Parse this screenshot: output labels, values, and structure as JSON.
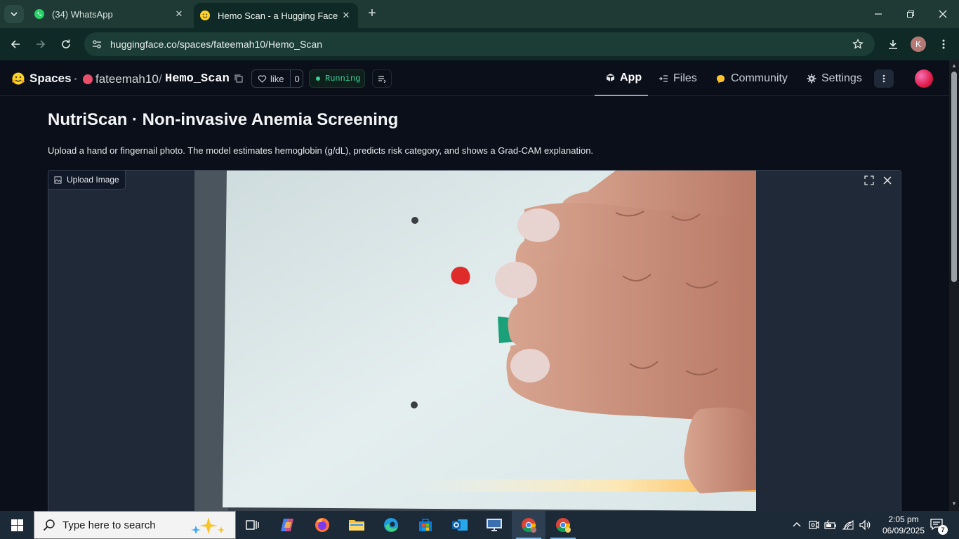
{
  "browser": {
    "tabs": [
      {
        "title": "(34) WhatsApp",
        "icon": "whatsapp-icon"
      },
      {
        "title": "Hemo Scan - a Hugging Face Space",
        "icon": "huggingface-icon"
      }
    ],
    "url": "huggingface.co/spaces/fateemah10/Hemo_Scan",
    "profile_initial": "K"
  },
  "hf_header": {
    "spaces_label": "Spaces",
    "owner": "fateemah10",
    "separator": "/",
    "repo": "Hemo_Scan",
    "like_label": "like",
    "like_count": "0",
    "status": "Running",
    "nav": [
      {
        "label": "App"
      },
      {
        "label": "Files"
      },
      {
        "label": "Community"
      },
      {
        "label": "Settings"
      }
    ]
  },
  "app": {
    "title": "NutriScan · Non-invasive Anemia Screening",
    "description": "Upload a hand or fingernail photo. The model estimates hemoglobin (g/dL), predicts risk category, and shows a Grad-CAM explanation.",
    "upload_label": "Upload Image"
  },
  "taskbar": {
    "search_placeholder": "Type here to search",
    "time": "2:05 pm",
    "date": "06/09/2025",
    "notification_count": "7"
  },
  "colors": {
    "tab_bar": "#1f3a35",
    "toolbar": "#0f2a26",
    "page_bg": "#0b0f19",
    "running_green": "#34d399",
    "taskbar": "#1c2a38"
  }
}
